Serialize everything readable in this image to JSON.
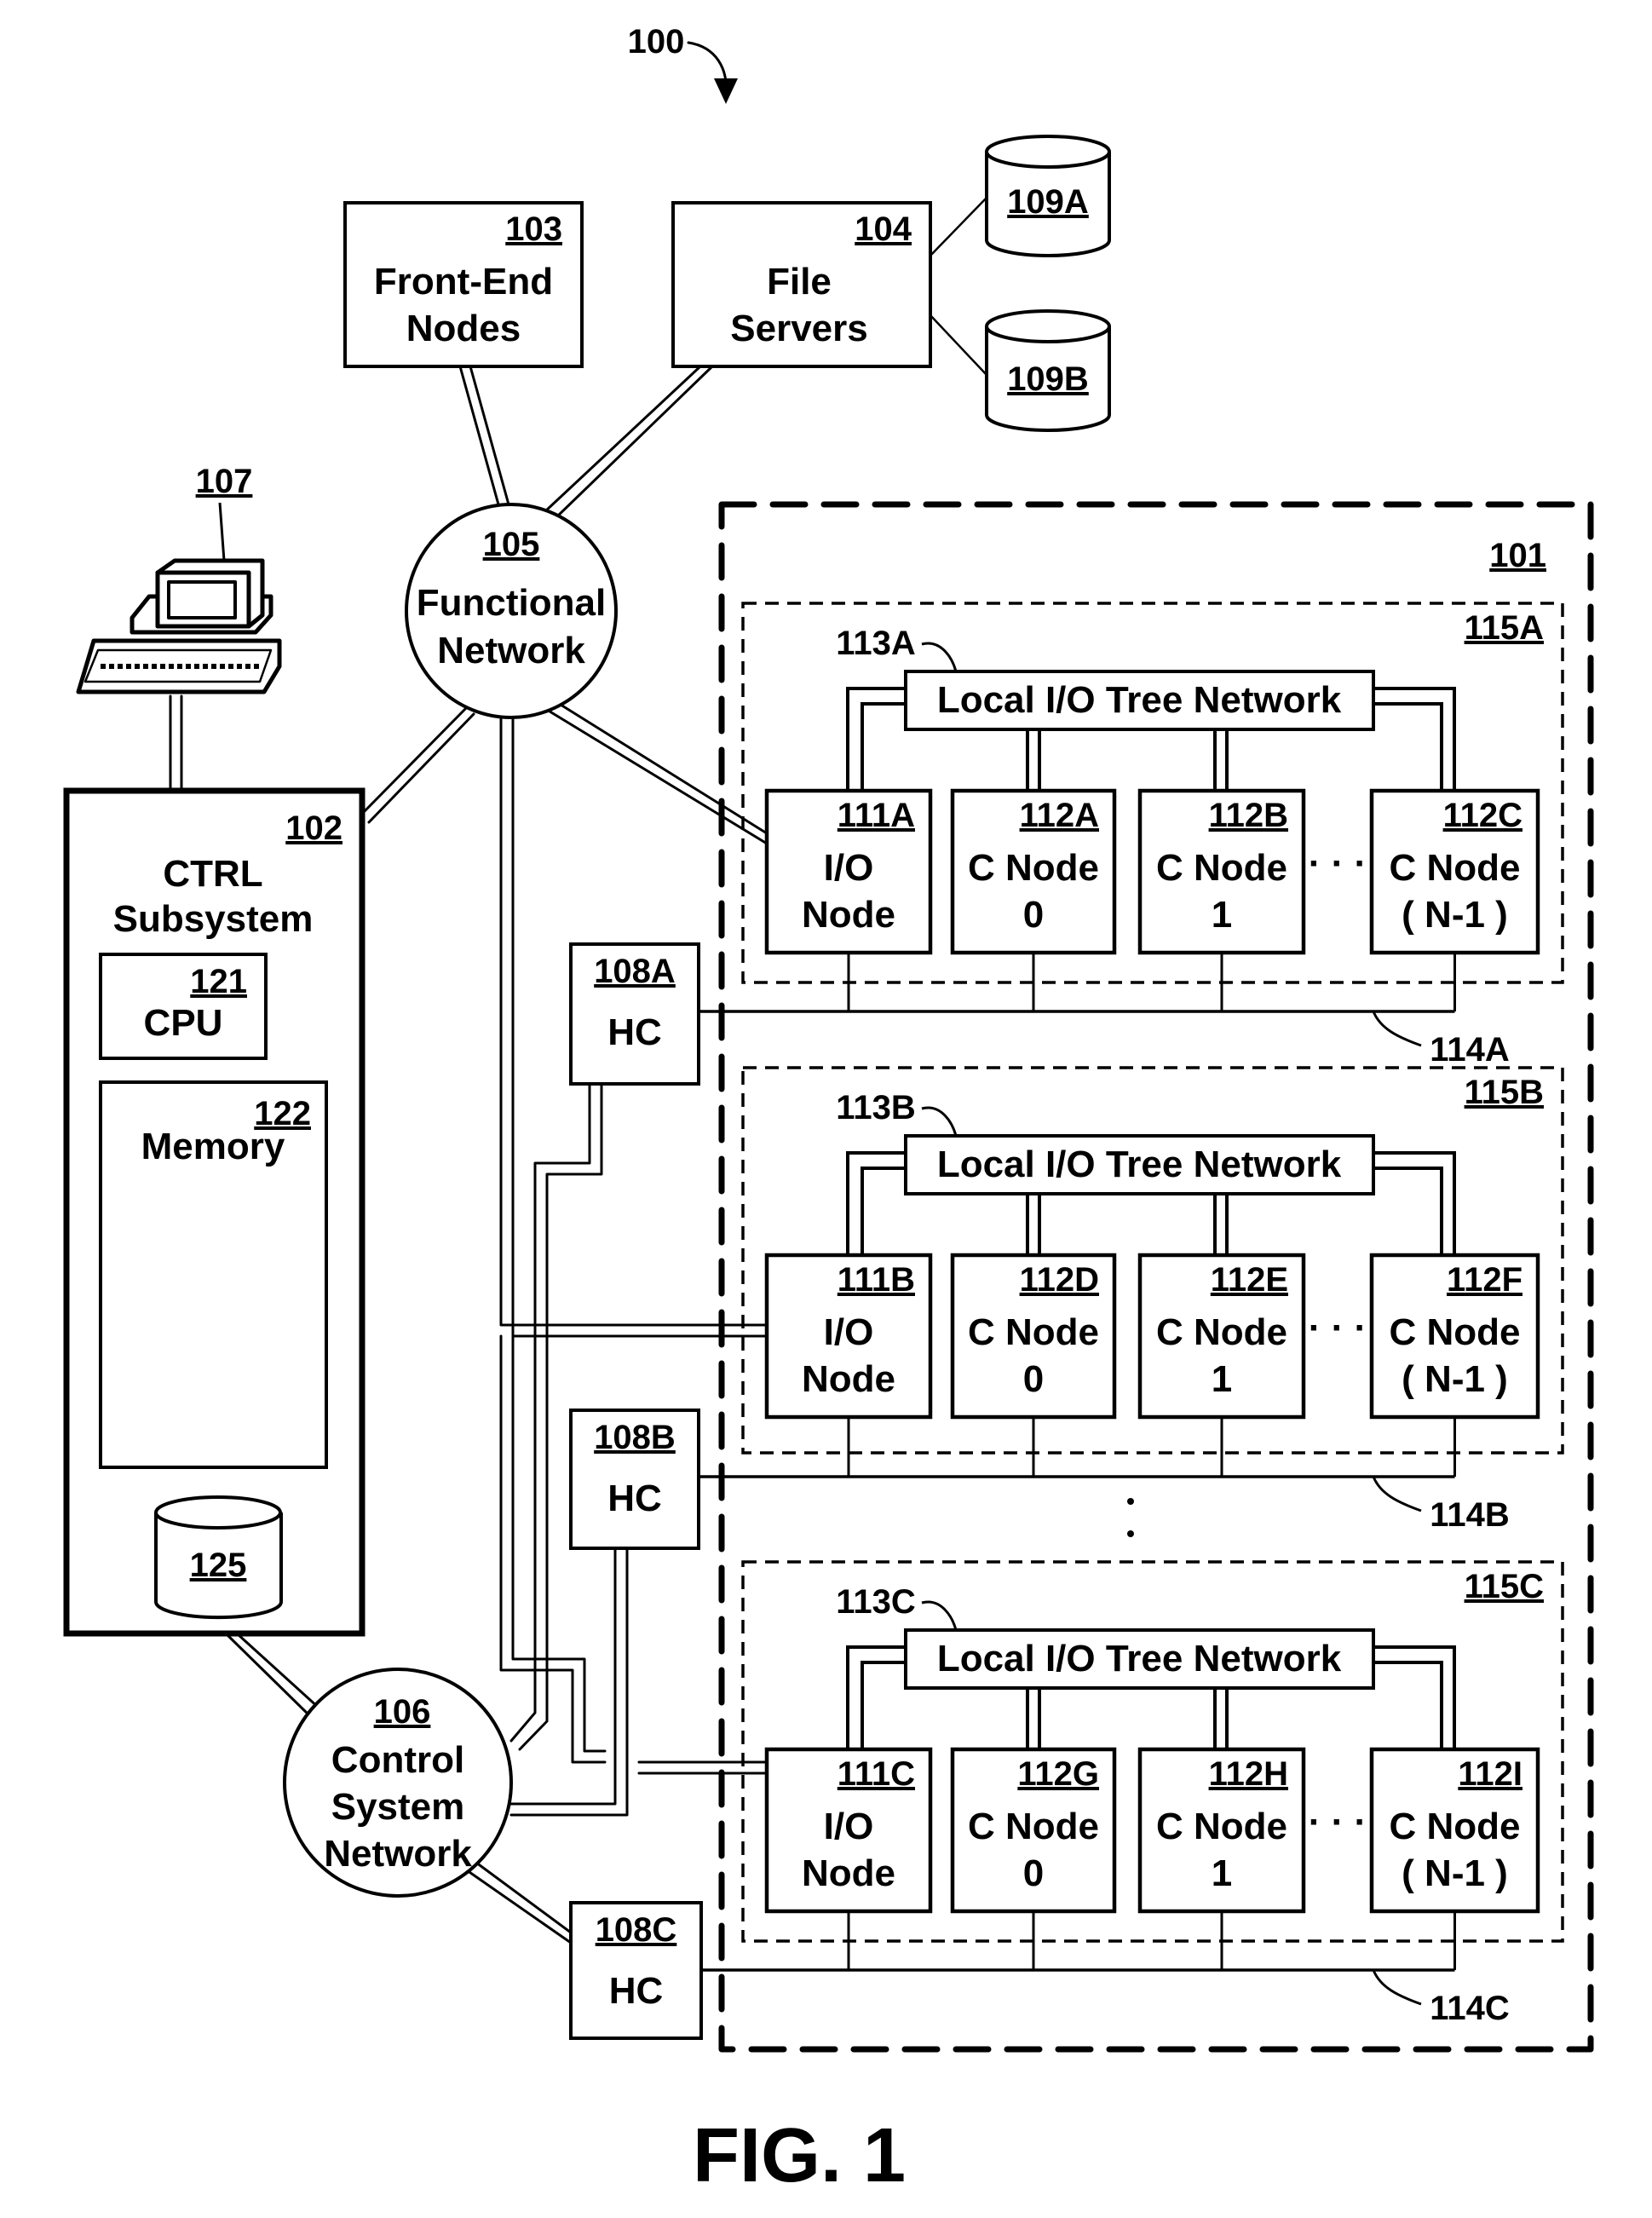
{
  "figure": {
    "system_ref": "100",
    "caption": "FIG. 1"
  },
  "front_end": {
    "ref": "103",
    "line1": "Front-End",
    "line2": "Nodes"
  },
  "file_servers": {
    "ref": "104",
    "line1": "File",
    "line2": "Servers"
  },
  "storage": [
    {
      "ref": "109A"
    },
    {
      "ref": "109B"
    }
  ],
  "functional_network": {
    "ref": "105",
    "line1": "Functional",
    "line2": "Network"
  },
  "terminal": {
    "ref": "107",
    "icon": "computer-terminal-icon"
  },
  "ctrl_subsystem": {
    "ref": "102",
    "line1": "CTRL",
    "line2": "Subsystem",
    "cpu": {
      "ref": "121",
      "label": "CPU"
    },
    "memory": {
      "ref": "122",
      "label": "Memory"
    },
    "storage": {
      "ref": "125"
    }
  },
  "control_network": {
    "ref": "106",
    "line1": "Control",
    "line2": "System",
    "line3": "Network"
  },
  "compute_core": {
    "ref": "101"
  },
  "hardware_controllers": [
    {
      "ref": "108A",
      "label": "HC"
    },
    {
      "ref": "108B",
      "label": "HC"
    },
    {
      "ref": "108C",
      "label": "HC"
    }
  ],
  "ellipsis": "· · ·",
  "blocks": [
    {
      "ref": "115A",
      "tree_ref": "113A",
      "tree_label": "Local I/O Tree Network",
      "bus_ref": "114A",
      "nodes": [
        {
          "ref": "111A",
          "line1": "I/O",
          "line2": "Node"
        },
        {
          "ref": "112A",
          "line1": "C Node",
          "line2": "0"
        },
        {
          "ref": "112B",
          "line1": "C Node",
          "line2": "1"
        },
        {
          "ref": "112C",
          "line1": "C Node",
          "line2": "( N-1 )"
        }
      ]
    },
    {
      "ref": "115B",
      "tree_ref": "113B",
      "tree_label": "Local I/O Tree Network",
      "bus_ref": "114B",
      "nodes": [
        {
          "ref": "111B",
          "line1": "I/O",
          "line2": "Node"
        },
        {
          "ref": "112D",
          "line1": "C Node",
          "line2": "0"
        },
        {
          "ref": "112E",
          "line1": "C Node",
          "line2": "1"
        },
        {
          "ref": "112F",
          "line1": "C Node",
          "line2": "( N-1 )"
        }
      ]
    },
    {
      "ref": "115C",
      "tree_ref": "113C",
      "tree_label": "Local I/O Tree Network",
      "bus_ref": "114C",
      "nodes": [
        {
          "ref": "111C",
          "line1": "I/O",
          "line2": "Node"
        },
        {
          "ref": "112G",
          "line1": "C Node",
          "line2": "0"
        },
        {
          "ref": "112H",
          "line1": "C Node",
          "line2": "1"
        },
        {
          "ref": "112I",
          "line1": "C Node",
          "line2": "( N-1 )"
        }
      ]
    }
  ]
}
